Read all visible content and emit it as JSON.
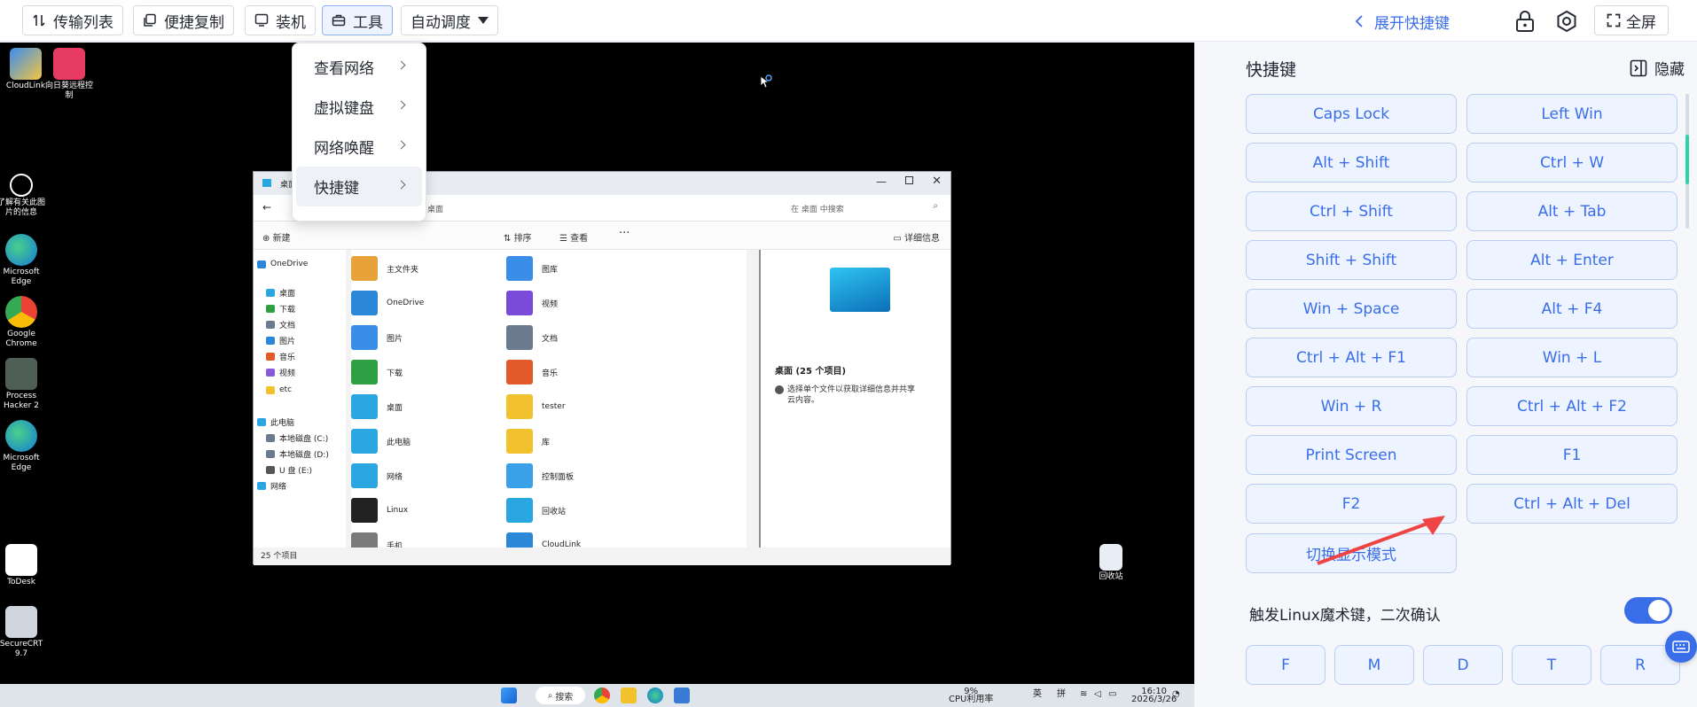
{
  "toolbar": {
    "transfer_list": "传输列表",
    "quick_copy": "便捷复制",
    "install": "装机",
    "tools": "工具",
    "auto_tune": "自动调度",
    "expand_shortcuts": "展开快捷键",
    "fullscreen": "全屏"
  },
  "tools_menu": {
    "items": [
      "查看网络",
      "虚拟键盘",
      "网络唤醒",
      "快捷键"
    ],
    "highlighted": "快捷键"
  },
  "panel": {
    "title": "快捷键",
    "hide": "隐藏",
    "shortcuts": [
      "Caps Lock",
      "Left Win",
      "Alt + Shift",
      "Ctrl + W",
      "Ctrl + Shift",
      "Alt + Tab",
      "Shift + Shift",
      "Alt + Enter",
      "Win + Space",
      "Alt + F4",
      "Ctrl + Alt + F1",
      "Win + L",
      "Win + R",
      "Ctrl + Alt + F2",
      "Print Screen",
      "F1",
      "F2",
      "Ctrl + Alt + Del"
    ],
    "switch_mode": "切换显示模式",
    "magic_key_label": "触发Linux魔术键，二次确认",
    "magic_key_enabled": true,
    "magic_keys": [
      "F",
      "M",
      "D",
      "T",
      "R"
    ]
  },
  "remote": {
    "desktop_icons": [
      "CloudLink",
      "向日葵远程控制",
      "了解有关此图片的信息",
      "Microsoft Edge",
      "Google Chrome",
      "Process Hacker 2",
      "Microsoft Edge",
      "ToDesk",
      "SecureCRT 9.7",
      "回收站"
    ],
    "explorer": {
      "title": "桌面",
      "crumb": "桌面",
      "search_placeholder": "在 桌面 中搜索",
      "new": "新建",
      "sort": "排序",
      "view": "查看",
      "details": "详细信息",
      "nav": [
        "OneDrive",
        "桌面",
        "下载",
        "文档",
        "图片",
        "音乐",
        "视频",
        "etc",
        "此电脑",
        "本地磁盘 (C:)",
        "本地磁盘 (D:)",
        "U 盘 (E:)",
        "网络"
      ],
      "files_left": [
        "主文件夹",
        "OneDrive",
        "图片",
        "下载",
        "桌面",
        "此电脑",
        "网络",
        "Linux",
        "手机"
      ],
      "files_right": [
        "图库",
        "视频",
        "文档",
        "音乐",
        "tester",
        "库",
        "控制面板",
        "回收站",
        "CloudLink"
      ],
      "detail_title": "桌面 (25 个项目)",
      "detail_hint": "选择单个文件以获取详细信息并共享云内容。",
      "status": "25 个项目"
    },
    "taskbar": {
      "search": "搜索",
      "cpu": "9%",
      "cpu_label": "CPU利用率",
      "ime1": "英",
      "ime2": "拼",
      "time": "16:10",
      "date": "2026/3/26"
    }
  },
  "colors": {
    "accent": "#3a6ee8",
    "shortcut_bg": "#edf3ff",
    "shortcut_border": "#b9cdf3",
    "panel_bg": "#f5f7fb",
    "annotation": "#ef4444"
  }
}
